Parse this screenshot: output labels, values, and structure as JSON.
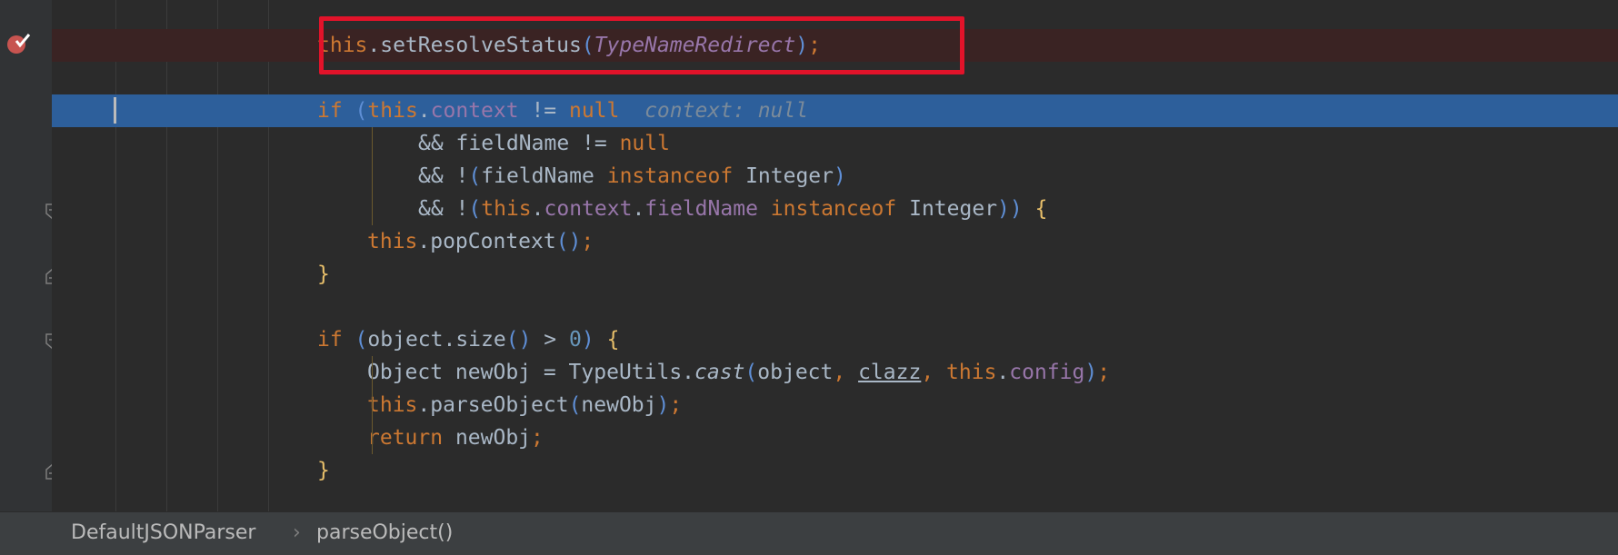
{
  "breakpoint": {
    "icon": "breakpoint-verified-icon",
    "color": "#c75450"
  },
  "highlight_box_color": "#e2132a",
  "lines": {
    "l1": {
      "this": "this",
      "method": ".setResolveStatus",
      "lp": "(",
      "arg": "TypeNameRedirect",
      "rp": ")",
      "semi": ";"
    },
    "l2": {
      "if": "if ",
      "lp": "(",
      "this": "this",
      "dot": ".",
      "field": "context",
      "op": " != ",
      "null": "null",
      "hint": "  context: null"
    },
    "l3": {
      "op": "&& ",
      "name": "fieldName",
      "op2": " != ",
      "null": "null"
    },
    "l4": {
      "op": "&& !",
      "lp": "(",
      "name": "fieldName ",
      "inst": "instanceof",
      "type": " Integer",
      "rp": ")"
    },
    "l5": {
      "op": "&& !",
      "lp": "(",
      "this": "this",
      "dot": ".",
      "field": "context",
      "dot2": ".",
      "field2": "fieldName",
      "sp": " ",
      "inst": "instanceof",
      "type": " Integer",
      "rp": "))",
      "sp2": " ",
      "brace": "{"
    },
    "l6": {
      "this": "this",
      "method": ".popContext",
      "parens": "()",
      "semi": ";"
    },
    "l7": {
      "brace": "}"
    },
    "l8": {
      "if": "if ",
      "lp": "(",
      "expr": "object.size",
      "parens": "()",
      "op": " > ",
      "num": "0",
      "rp": ")",
      "sp": " ",
      "brace": "{"
    },
    "l9": {
      "decl": "Object newObj = TypeUtils.",
      "cast": "cast",
      "lp": "(",
      "obj": "object",
      "comma": ", ",
      "clazz": "clazz",
      "comma2": ", ",
      "this": "this",
      "dot": ".",
      "field": "config",
      "rp": ")",
      "semi": ";"
    },
    "l10": {
      "this": "this",
      "method": ".parseObject",
      "lp": "(",
      "arg": "newObj",
      "rp": ")",
      "semi": ";"
    },
    "l11": {
      "ret": "return",
      "val": " newObj",
      "semi": ";"
    },
    "l12": {
      "brace": "}"
    }
  },
  "breadcrumb": {
    "class_name": "DefaultJSONParser",
    "separator": "›",
    "method_name": "parseObject()"
  }
}
